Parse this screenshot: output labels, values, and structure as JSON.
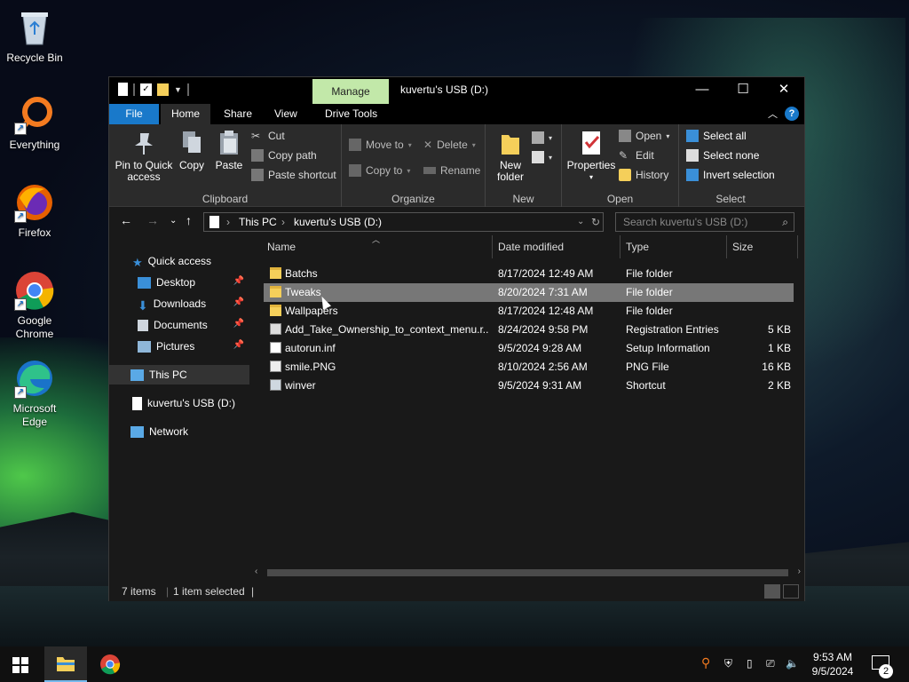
{
  "desktop": {
    "icons": [
      {
        "label": "Recycle Bin"
      },
      {
        "label": "Everything"
      },
      {
        "label": "Firefox"
      },
      {
        "label": "Google Chrome"
      },
      {
        "label": "Microsoft Edge"
      }
    ]
  },
  "window": {
    "title": "kuvertu's USB (D:)",
    "manage_tab": "Manage",
    "menu": {
      "file": "File",
      "home": "Home",
      "share": "Share",
      "view": "View",
      "drive_tools": "Drive Tools",
      "help": "?"
    },
    "ribbon": {
      "clipboard": {
        "label": "Clipboard",
        "pin": "Pin to Quick access",
        "copy": "Copy",
        "paste": "Paste",
        "cut": "Cut",
        "copy_path": "Copy path",
        "paste_shortcut": "Paste shortcut"
      },
      "organize": {
        "label": "Organize",
        "move_to": "Move to",
        "copy_to": "Copy to",
        "delete": "Delete",
        "rename": "Rename"
      },
      "new": {
        "label": "New",
        "new_folder": "New folder"
      },
      "open": {
        "label": "Open",
        "properties": "Properties",
        "open": "Open",
        "edit": "Edit",
        "history": "History"
      },
      "select": {
        "label": "Select",
        "select_all": "Select all",
        "select_none": "Select none",
        "invert": "Invert selection"
      }
    },
    "address": {
      "crumbs": [
        "This PC",
        "kuvertu's USB (D:)"
      ],
      "search_placeholder": "Search kuvertu's USB (D:)"
    },
    "nav": {
      "quick_access": "Quick access",
      "desktop": "Desktop",
      "downloads": "Downloads",
      "documents": "Documents",
      "pictures": "Pictures",
      "this_pc": "This PC",
      "usb": "kuvertu's USB (D:)",
      "network": "Network"
    },
    "columns": {
      "name": "Name",
      "date": "Date modified",
      "type": "Type",
      "size": "Size"
    },
    "files": [
      {
        "name": "Batchs",
        "date": "8/17/2024 12:49 AM",
        "type": "File folder",
        "size": ""
      },
      {
        "name": "Tweaks",
        "date": "8/20/2024 7:31 AM",
        "type": "File folder",
        "size": ""
      },
      {
        "name": "Wallpapers",
        "date": "8/17/2024 12:48 AM",
        "type": "File folder",
        "size": ""
      },
      {
        "name": "Add_Take_Ownership_to_context_menu.r...",
        "date": "8/24/2024 9:58 PM",
        "type": "Registration Entries",
        "size": "5 KB"
      },
      {
        "name": "autorun.inf",
        "date": "9/5/2024 9:28 AM",
        "type": "Setup Information",
        "size": "1 KB"
      },
      {
        "name": "smile.PNG",
        "date": "8/10/2024 2:56 AM",
        "type": "PNG File",
        "size": "16 KB"
      },
      {
        "name": "winver",
        "date": "9/5/2024 9:31 AM",
        "type": "Shortcut",
        "size": "2 KB"
      }
    ],
    "status": {
      "items": "7 items",
      "selected": "1 item selected"
    }
  },
  "taskbar": {
    "time": "9:53 AM",
    "date": "9/5/2024",
    "notifications": "2"
  },
  "colors": {
    "accent": "#1979ca",
    "manage": "#c2e8a9",
    "selection": "#777777",
    "folder": "#f5cf5a"
  }
}
